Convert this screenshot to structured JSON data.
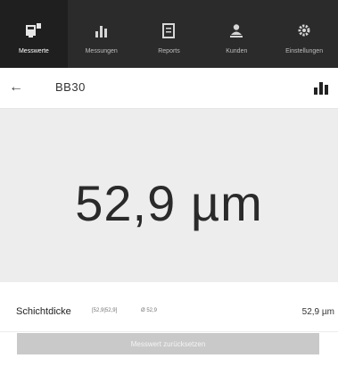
{
  "nav": {
    "items": [
      {
        "label": "Messwerte",
        "icon": "measurements-icon",
        "active": true
      },
      {
        "label": "Messungen",
        "icon": "bar-chart-icon",
        "active": false
      },
      {
        "label": "Reports",
        "icon": "document-icon",
        "active": false
      },
      {
        "label": "Kunden",
        "icon": "person-upload-icon",
        "active": false
      },
      {
        "label": "Einstellungen",
        "icon": "gear-icon",
        "active": false
      }
    ]
  },
  "header": {
    "back_icon": "back-arrow-icon",
    "title": "BB30",
    "chart_icon": "bar-chart-icon"
  },
  "reading": {
    "value": "52,9 µm"
  },
  "parameter": {
    "label": "Schichtdicke",
    "range": "[52,9|52,9]",
    "average": "Ø 52,9",
    "value": "52,9 µm"
  },
  "actions": {
    "delete_label": "Messwert zurücksetzen"
  }
}
